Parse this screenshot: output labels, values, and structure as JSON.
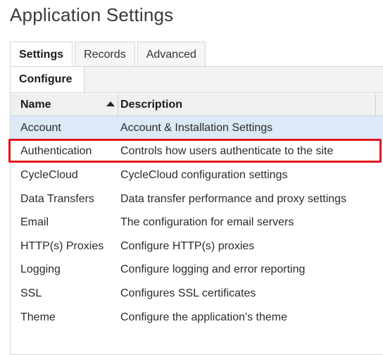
{
  "page": {
    "title": "Application Settings"
  },
  "tabs": [
    {
      "label": "Settings",
      "active": true
    },
    {
      "label": "Records",
      "active": false
    },
    {
      "label": "Advanced",
      "active": false
    }
  ],
  "subtabs": [
    {
      "label": "Configure",
      "active": true
    }
  ],
  "table": {
    "columns": [
      {
        "label": "Name",
        "sort": "ascending"
      },
      {
        "label": "Description"
      }
    ],
    "rows": [
      {
        "name": "Account",
        "description": "Account & Installation Settings",
        "selected": true
      },
      {
        "name": "Authentication",
        "description": "Controls how users authenticate to the site",
        "highlighted": true
      },
      {
        "name": "CycleCloud",
        "description": "CycleCloud configuration settings"
      },
      {
        "name": "Data Transfers",
        "description": "Data transfer performance and proxy settings"
      },
      {
        "name": "Email",
        "description": "The configuration for email servers"
      },
      {
        "name": "HTTP(s) Proxies",
        "description": "Configure HTTP(s) proxies"
      },
      {
        "name": "Logging",
        "description": "Configure logging and error reporting"
      },
      {
        "name": "SSL",
        "description": "Configures SSL certificates"
      },
      {
        "name": "Theme",
        "description": "Configure the application's theme"
      }
    ]
  },
  "colors": {
    "selected_row": "#dce9f7",
    "highlight_outline": "#e2161c"
  }
}
